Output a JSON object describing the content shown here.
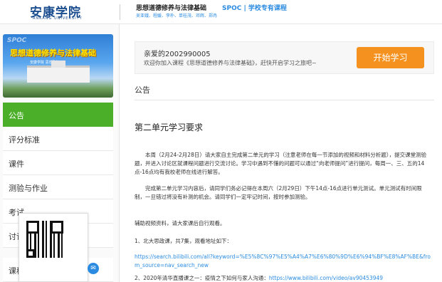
{
  "header": {
    "logo_text": "安康学院",
    "logo_sub": "ANKANG UNIVERSITY",
    "course_title": "思想道德修养与法律基础",
    "spoc_label": "SPOC | 学校专有课程",
    "teachers": "吴亚娥、程媛、李朴、单桂茂、邓辉、郑冉"
  },
  "sidebar": {
    "banner_tag": "SPOC",
    "banner_title": "思想道德修养与法律基础",
    "banner_caption": "安康学院 思想政治",
    "items": [
      {
        "label": "公告",
        "active": true
      },
      {
        "label": "评分标准",
        "active": false
      },
      {
        "label": "课件",
        "active": false
      },
      {
        "label": "测验与作业",
        "active": false
      },
      {
        "label": "考试",
        "active": false
      },
      {
        "label": "讨论",
        "active": false
      },
      {
        "label": "课程",
        "active": false
      }
    ]
  },
  "welcome": {
    "greeting": "亲爱的2002990005",
    "message": "欢迎你加入课程《思想道德修养与法律基础》，赶快开启学习之旅吧~",
    "start_button": "开始学习"
  },
  "content": {
    "section_title": "公告",
    "announcement_title": "第二单元学习要求",
    "para1": "本周（2月24-2月28日）请大家自主完成第二单元的学习（注意老师在每一节添加的视频和材料分析题），提交课堂测验题，并进入讨论区就课程问题进行交流讨论。学习中遇到不懂的问题可以通过“向老师提问”进行提问，每周一、三、五的14点-16点均有我校老师在线进行解答。",
    "para2": "完成第二单元学习内容后，请同学们务必记得在本周六（2月29日）下午14点-16点进行单元测试。单元测试有时间限制，一旦错过将没有补测的机会。请同学们一定牢记时间，按时参加测验。",
    "para3": "辅助视频资料，请大家课后自行观看。",
    "item1": "1、北大思政课，共7集，观看地址如下：",
    "link1": "https://search.bilibili.com/all?keyword=%E5%8C%97%E5%A4%A7%E6%80%9D%E6%94%BF%E8%AF%BE&from_source=nav_search_new",
    "item2_prefix": "2、2020年清华直播课之一：疫情之下如何与家人沟通：",
    "link2": "https://www.bilibili.com/video/av90453949"
  }
}
